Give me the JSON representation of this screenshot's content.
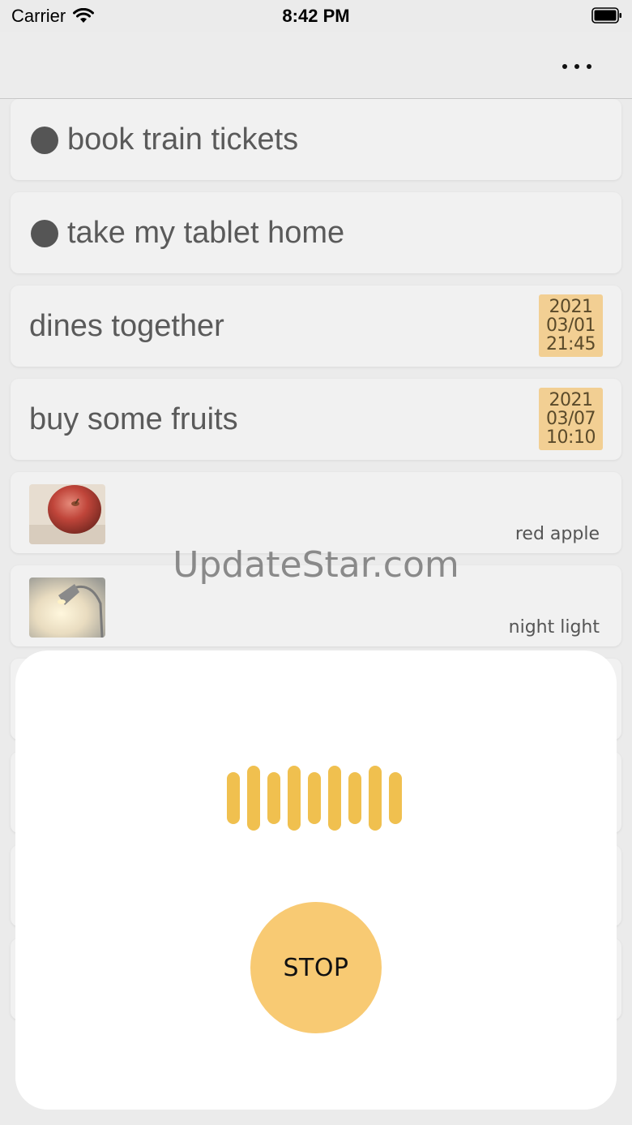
{
  "status_bar": {
    "carrier": "Carrier",
    "time": "8:42 PM"
  },
  "colors": {
    "badge": "#f2cf93",
    "accent": "#f8ca73",
    "wave": "#f0c04f",
    "card": "#f1f1f1"
  },
  "tasks": [
    {
      "title": "book train tickets",
      "bullet": true
    },
    {
      "title": "take my tablet home",
      "bullet": true
    },
    {
      "title": "dines together",
      "date": [
        "2021",
        "03/01",
        "21:45"
      ]
    },
    {
      "title": "buy some fruits",
      "date": [
        "2021",
        "03/07",
        "10:10"
      ]
    },
    {
      "caption": "red apple",
      "image": "apple-photo"
    },
    {
      "caption": "night light",
      "image": "desk-lamp-photo"
    }
  ],
  "watermark": "UpdateStar.com",
  "recorder": {
    "stop_label": "STOP",
    "icon": "sound-wave-icon"
  },
  "icons": {
    "more": "more-horizontal-icon",
    "wifi": "wifi-icon",
    "battery": "battery-icon"
  }
}
